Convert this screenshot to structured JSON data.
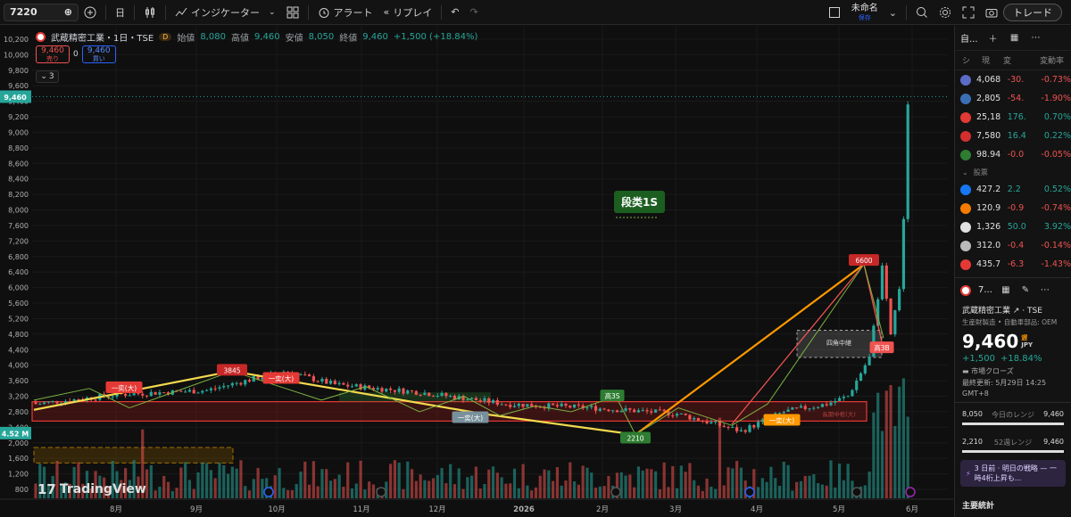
{
  "toolbar": {
    "symbol": "7220",
    "interval": "日",
    "indicators_label": "インジケーター",
    "alert_label": "アラート",
    "replay_label": "リプレイ",
    "layout_name": "未命名",
    "layout_status": "保存",
    "trade_label": "トレード"
  },
  "legend": {
    "title": "武蔵精密工業・1日・TSE",
    "badge": "D",
    "open_label": "始値",
    "open": "8,080",
    "high_label": "高値",
    "high": "9,460",
    "low_label": "安値",
    "low": "8,050",
    "close_label": "終値",
    "close": "9,460",
    "change": "+1,500 (+18.84%)",
    "sell_price": "9,460",
    "sell_label": "売り",
    "spread": "0",
    "buy_price": "9,460",
    "buy_label": "買い",
    "collapse": "3"
  },
  "chart_data": {
    "type": "candlestick",
    "y_ticks": [
      "10,200",
      "10,000",
      "9,800",
      "9,600",
      "9,400",
      "9,200",
      "9,000",
      "8,800",
      "8,600",
      "8,400",
      "8,200",
      "8,000",
      "7,600",
      "7,200",
      "6,800",
      "6,400",
      "6,000",
      "5,600",
      "5,200",
      "4,800",
      "4,400",
      "4,000",
      "3,600",
      "3,200",
      "2,800",
      "2,400",
      "2,000",
      "1,600",
      "1,200",
      "800"
    ],
    "x_ticks": [
      "8月",
      "9月",
      "10月",
      "11月",
      "12月",
      "2026",
      "2月",
      "3月",
      "4月",
      "5月",
      "6月"
    ],
    "last_price_label": "9,460",
    "volume_label": "4.52 M",
    "annotations": [
      "一奕(大)",
      "3845",
      "一奕(大)",
      "一奕(大)",
      "高3S",
      "2210",
      "一奕(大)",
      "6600",
      "高3B",
      "四角中継",
      "長期中枢(大)"
    ],
    "indicator_label": "段类1S"
  },
  "watchlist": {
    "title": "自...",
    "columns": [
      "シ",
      "現",
      "変",
      "変動率"
    ],
    "rows": [
      {
        "color": "#5b6cc7",
        "last": "4,068",
        "chg": "-30.",
        "pct": "-0.73%",
        "dir": "neg"
      },
      {
        "color": "#3a6fb5",
        "last": "2,805",
        "chg": "-54.",
        "pct": "-1.90%",
        "dir": "neg"
      },
      {
        "color": "#e53935",
        "last": "25,18",
        "chg": "176.",
        "pct": "0.70%",
        "dir": "pos"
      },
      {
        "color": "#d32f2f",
        "last": "7,580",
        "chg": "16.4",
        "pct": "0.22%",
        "dir": "pos"
      },
      {
        "color": "#2e7d32",
        "last": "98.94",
        "chg": "-0.0",
        "pct": "-0.05%",
        "dir": "neg"
      }
    ],
    "section_label": "股票",
    "rows2": [
      {
        "color": "#1877f2",
        "last": "427.2",
        "chg": "2.2",
        "pct": "0.52%",
        "dir": "pos"
      },
      {
        "color": "#f57c00",
        "last": "120.9",
        "chg": "-0.9",
        "pct": "-0.74%",
        "dir": "neg"
      },
      {
        "color": "#e0e0e0",
        "last": "1,326",
        "chg": "50.0",
        "pct": "3.92%",
        "dir": "pos"
      },
      {
        "color": "#bbbbbb",
        "last": "312.0",
        "chg": "-0.4",
        "pct": "-0.14%",
        "dir": "neg"
      },
      {
        "color": "#e53935",
        "last": "435.7",
        "chg": "-6.3",
        "pct": "-1.43%",
        "dir": "neg"
      }
    ]
  },
  "details": {
    "symbol": "7...",
    "name": "武蔵精密工業 ↗ · TSE",
    "sector": "生産財製造 • 自動車部品: OEM",
    "price": "9,460",
    "currency_top": "遅",
    "currency": "JPY",
    "change": "+1,500",
    "change_pct": "+18.84%",
    "market_status": "市場クローズ",
    "last_update": "最終更新: 5月29日 14:25",
    "tz": "GMT+8",
    "day_low": "8,050",
    "day_label": "今日のレンジ",
    "day_high": "9,460",
    "w52_low": "2,210",
    "w52_label": "52週レンジ",
    "w52_high": "9,460",
    "promo": "3 日前 · 明日の戦略 — 一時4桁上昇も...",
    "stats_title": "主要統計"
  }
}
